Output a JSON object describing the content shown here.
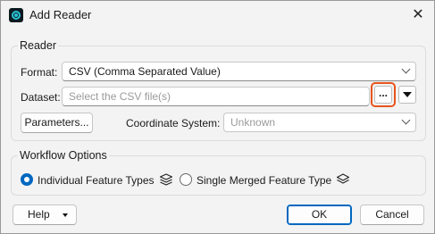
{
  "window": {
    "title": "Add Reader",
    "app_icon": "fme-logo-icon",
    "close_glyph": "✕"
  },
  "reader": {
    "group_label": "Reader",
    "format_label": "Format:",
    "format_value": "CSV (Comma Separated Value)",
    "dataset_label": "Dataset:",
    "dataset_placeholder": "Select the CSV file(s)",
    "browse_label": "...",
    "parameters_label": "Parameters...",
    "coordinate_system_label": "Coordinate System:",
    "coordinate_system_value": "Unknown"
  },
  "workflow": {
    "group_label": "Workflow Options",
    "options": [
      {
        "label": "Individual Feature Types",
        "checked": true,
        "icon": "layers-icon"
      },
      {
        "label": "Single Merged Feature Type",
        "checked": false,
        "icon": "layers-icon"
      }
    ]
  },
  "footer": {
    "help_label": "Help",
    "ok_label": "OK",
    "cancel_label": "Cancel"
  },
  "colors": {
    "accent": "#0067c0",
    "highlight": "#e8541e",
    "background": "#f3f3f3"
  }
}
